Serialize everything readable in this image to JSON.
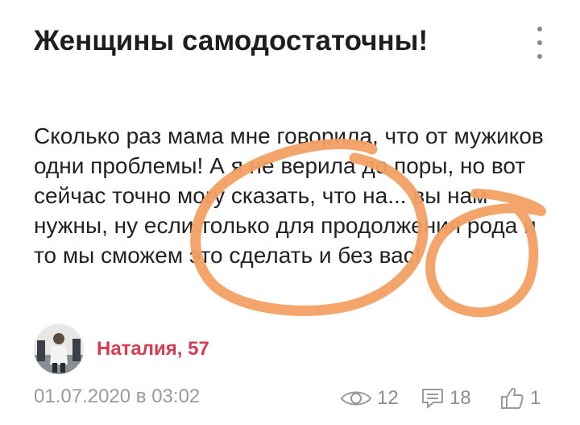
{
  "post": {
    "title": "Женщины самодостаточны!",
    "body": "Сколько раз мама мне говорила, что от мужиков одни проблемы! А я не верила до поры, но вот сейчас точно могу сказать, что на... вы нам нужны, ну если только для продолжения рода и то мы сможем это сделать и без вас!",
    "menu_icon": "more-vertical-icon"
  },
  "author": {
    "name": "Наталия, 57",
    "avatar_icon": "avatar-photo"
  },
  "meta": {
    "date": "01.07.2020 в 03:02",
    "views": "12",
    "comments": "18",
    "likes": "1",
    "views_icon": "eye-icon",
    "comments_icon": "comment-icon",
    "likes_icon": "thumbs-up-icon"
  },
  "colors": {
    "author_accent": "#d83a52",
    "annotation": "#f3a064"
  }
}
